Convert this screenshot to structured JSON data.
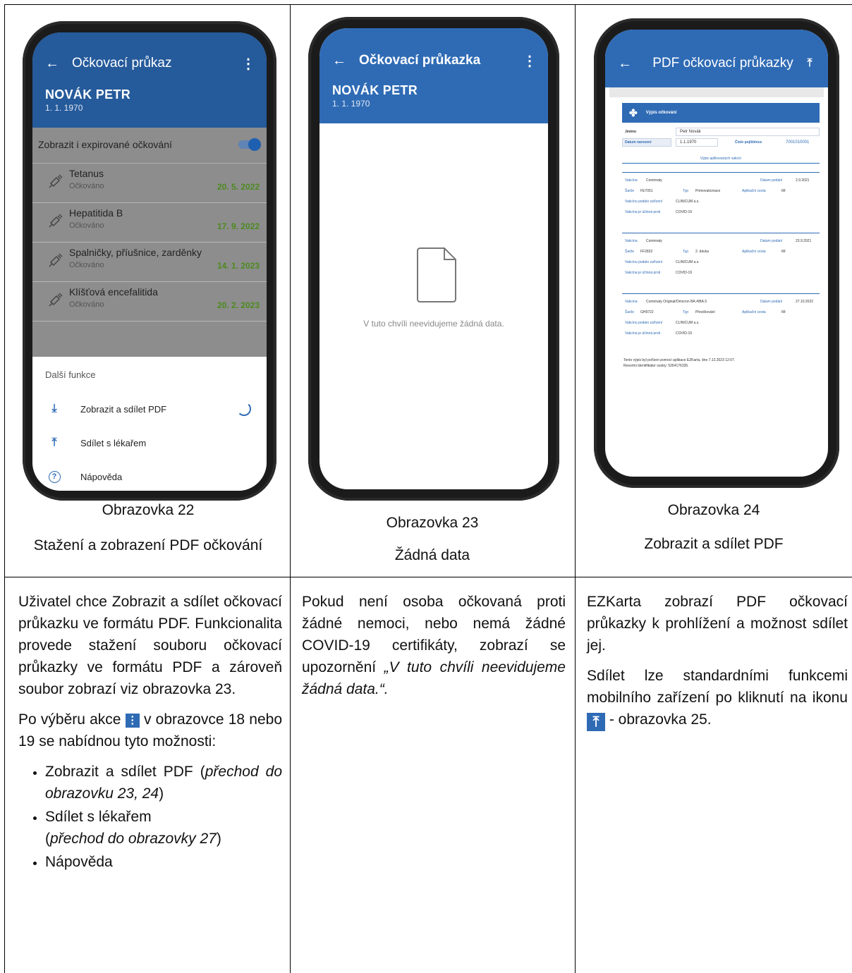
{
  "screens": [
    {
      "caption_title": "Obrazovka 22",
      "caption_subtitle": "Stažení a zobrazení PDF očkování",
      "appbar": {
        "title": "Očkovací průkaz",
        "name": "NOVÁK PETR",
        "dob": "1. 1. 1970"
      },
      "toggle_label": "Zobrazit i expirované očkování",
      "vaccinations": [
        {
          "name": "Tetanus",
          "status": "Očkováno",
          "date": "20. 5. 2022"
        },
        {
          "name": "Hepatitida B",
          "status": "Očkováno",
          "date": "17. 9. 2022"
        },
        {
          "name": "Spalničky, příušnice, zarděnky",
          "status": "Očkováno",
          "date": "14. 1. 2023"
        },
        {
          "name": "Klíšťová encefalitida",
          "status": "Očkováno",
          "date": "20. 2. 2023"
        }
      ],
      "sheet": {
        "title": "Další funkce",
        "items": [
          "Zobrazit a sdílet PDF",
          "Sdílet s lékařem",
          "Nápověda"
        ]
      }
    },
    {
      "caption_title": "Obrazovka 23",
      "caption_subtitle": "Žádná data",
      "appbar": {
        "title": "Očkovací průkazka",
        "name": "NOVÁK PETR",
        "dob": "1. 1. 1970"
      },
      "empty_text": "V tuto chvíli neevidujeme žádná data."
    },
    {
      "caption_title": "Obrazovka 24",
      "caption_subtitle": "Zobrazit a sdílet PDF",
      "appbar": {
        "title": "PDF očkovací průkazky"
      },
      "pdf": {
        "header": "Výpis očkování",
        "name_label": "Jméno",
        "name_value": "Petr Novák",
        "dob_label": "Datum narození",
        "dob_value": "1.1.1970",
        "ins_label": "Číslo pojištěnce",
        "ins_value": "7001010001",
        "section": "Výpis aplikovaných vakcín",
        "footer1": "Tento výpis byl pořízen pomocí aplikace EZKarta, dne 7.12.2023 12:07.",
        "footer2": "Resortní identifikátor osoby: 5264176335.",
        "records": [
          {
            "vakcina": "Comirnaty",
            "datum": "2.9.2021",
            "sarze": "FE7051",
            "typ": "Primovakcinace",
            "cesta": "IM",
            "zarizeni": "CLINICUM a.s.",
            "proti": "COVID-19"
          },
          {
            "vakcina": "Comirnaty",
            "datum": "23.9.2021",
            "sarze": "FF2832",
            "typ": "2. dávka",
            "cesta": "IM",
            "zarizeni": "CLINICUM a.s.",
            "proti": "COVID-19"
          },
          {
            "vakcina": "Comirnaty Original/Omicron BA.4/BA.5",
            "datum": "27.10.2022",
            "sarze": "GH9722",
            "typ": "Přeočkování",
            "cesta": "IM",
            "zarizeni": "CLINICUM a.s.",
            "proti": "COVID-19"
          }
        ],
        "labels": {
          "vakcina": "Vakcína",
          "datum": "Datum podání",
          "sarze": "Šarže",
          "typ": "Typ",
          "cesta": "Aplikační cesta",
          "zarizeni": "Vakcínu podalo zařízení",
          "proti": "Vakcína je účinná proti"
        }
      }
    }
  ],
  "descriptions": {
    "col1_p1": "Uživatel chce Zobrazit a sdílet očkovací průkazku ve formátu PDF. Funkcionalita provede stažení souboru očkovací průkazky ve formátu PDF a zároveň soubor zobrazí viz obrazovka 23.",
    "col1_p2_a": "Po výběru akce",
    "col1_p2_b": "v obrazovce 18 nebo 19 se nabídnou tyto možnosti:",
    "col1_list": [
      {
        "main": "Zobrazit a sdílet PDF",
        "note_a": "(",
        "note": "přechod do obrazovku 23, 24",
        "note_b": ")"
      },
      {
        "main": "Sdílet s lékařem",
        "note_a": "(",
        "note": "přechod do obrazovky 27",
        "note_b": ")"
      },
      {
        "main": "Nápověda"
      }
    ],
    "col2_p1": "Pokud není osoba očkovaná proti žádné nemoci, nebo nemá žádné COVID-19 certifikáty, zobrazí se upozornění",
    "col2_quote": "„V tuto chvíli neevidujeme žádná data.“.",
    "col3_p1": "EZKarta zobrazí PDF očkovací průkazky k prohlížení a možnost sdílet jej.",
    "col3_p2_a": "Sdílet lze standardními funkcemi mobilního zařízení po kliknutí na ikonu",
    "col3_p2_b": "- obrazovka 25."
  },
  "colors": {
    "brand": "#2f6bb5",
    "date_green": "#4c8a1f"
  },
  "icons": [
    "back-arrow-icon",
    "more-vert-icon",
    "syringe-icon",
    "download-icon",
    "upload-icon",
    "help-icon",
    "spinner-icon",
    "file-icon",
    "lion-emblem-icon"
  ]
}
